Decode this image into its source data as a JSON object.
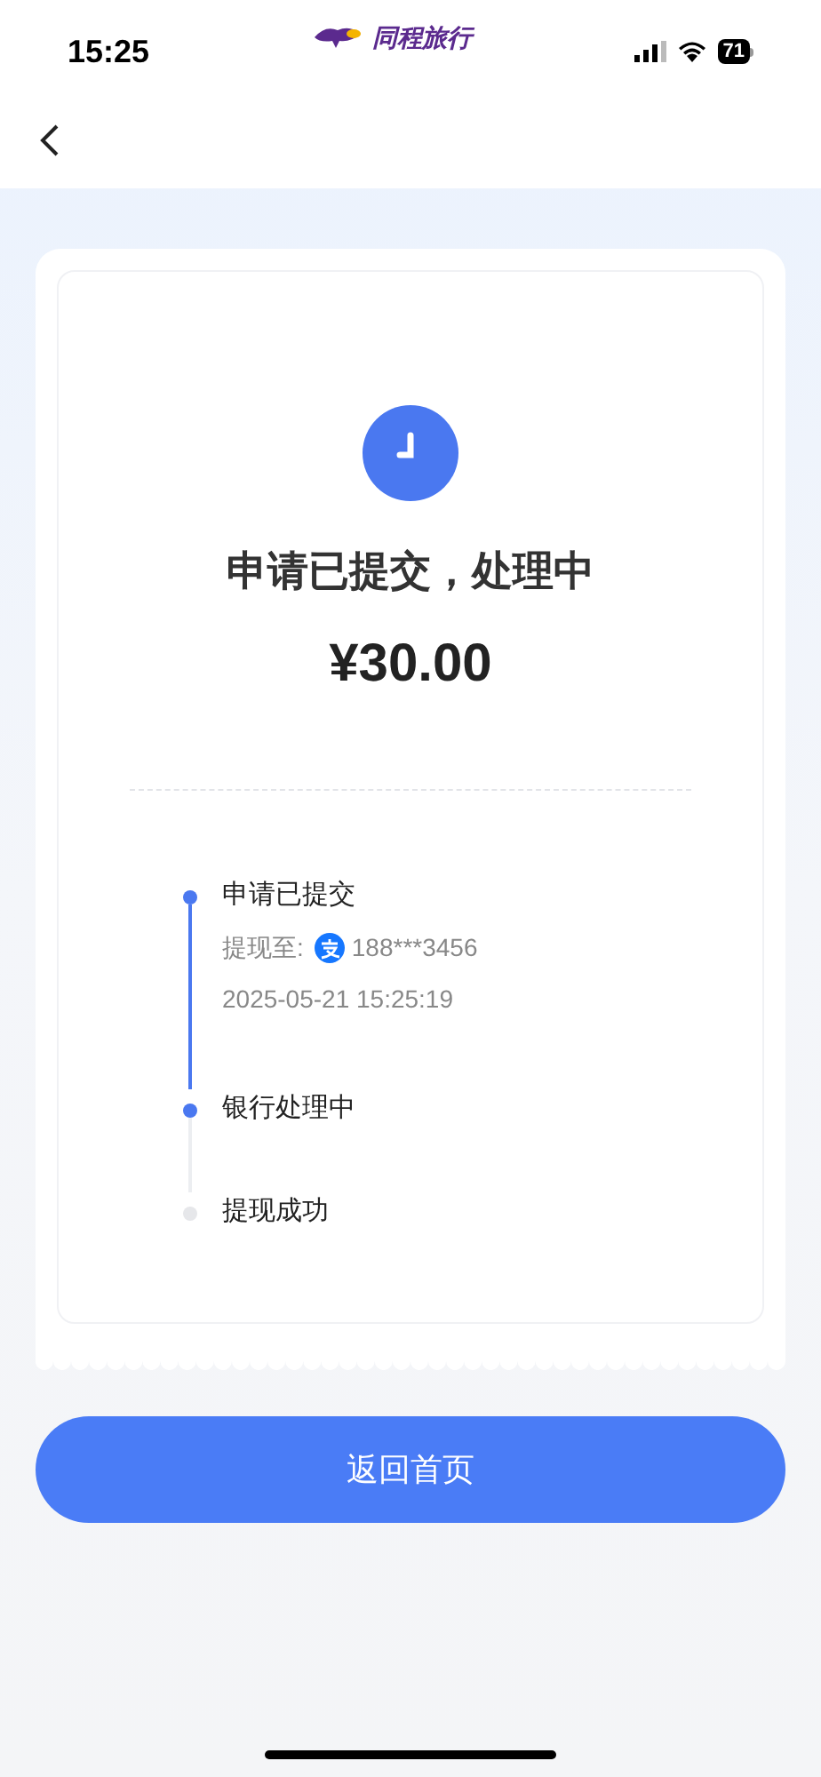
{
  "status_bar": {
    "time": "15:25",
    "app_name": "同程旅行",
    "battery": "71"
  },
  "result": {
    "title": "申请已提交，处理中",
    "amount": "¥30.00"
  },
  "steps": [
    {
      "label": "申请已提交",
      "done": true,
      "account_label": "提现至:",
      "account": "188***3456",
      "time": "2025-05-21 15:25:19"
    },
    {
      "label": "银行处理中",
      "done": true
    },
    {
      "label": "提现成功",
      "done": false
    }
  ],
  "button": "返回首页"
}
